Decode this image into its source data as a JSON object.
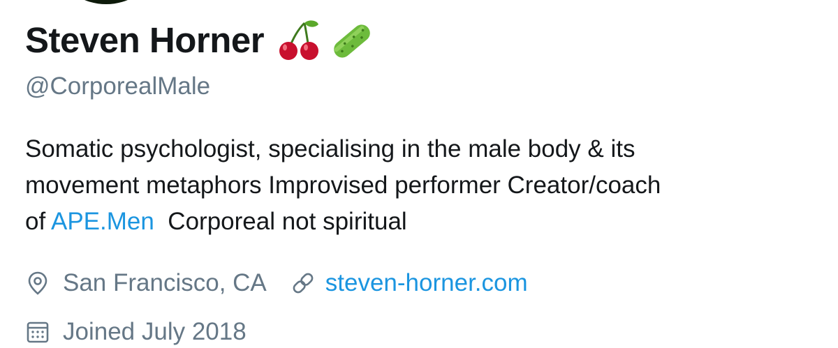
{
  "profile": {
    "display_name": "Steven Horner",
    "name_emojis": [
      "cherries-emoji",
      "cucumber-emoji"
    ],
    "handle": "@CorporealMale",
    "bio": {
      "line1": "Somatic psychologist, specialising in the male body & its",
      "line2": "movement metaphors Improvised performer Creator/coach",
      "line3_prefix": "of ",
      "line3_link": "APE.Men",
      "line3_suffix": "  Corporeal not spiritual"
    },
    "location": "San Francisco, CA",
    "website": "steven-horner.com",
    "joined": "Joined July 2018"
  },
  "icons": {
    "location": "location-pin-icon",
    "website": "link-icon",
    "joined": "calendar-icon"
  },
  "colors": {
    "name": "#14171a",
    "secondary": "#657786",
    "link": "#1b95e0",
    "background": "#ffffff"
  }
}
